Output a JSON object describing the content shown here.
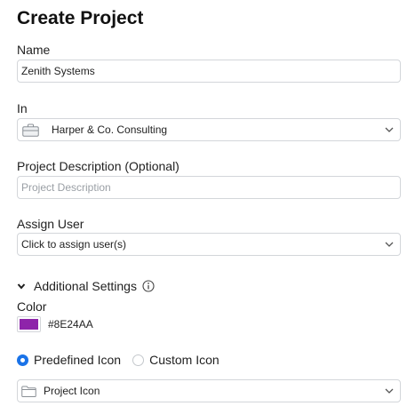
{
  "header": {
    "title": "Create Project"
  },
  "form": {
    "name": {
      "label": "Name",
      "value": "Zenith Systems"
    },
    "parent": {
      "label": "In",
      "value": "Harper & Co. Consulting",
      "icon": "briefcase-icon"
    },
    "description": {
      "label": "Project Description (Optional)",
      "placeholder": "Project Description"
    },
    "assign_user": {
      "label": "Assign User",
      "value": "Click to assign user(s)"
    },
    "additional_settings": {
      "label": "Additional Settings",
      "expanded": true,
      "color": {
        "label": "Color",
        "value": "#8E24AA"
      },
      "icon_type": {
        "options": [
          "Predefined Icon",
          "Custom Icon"
        ],
        "selected": "Predefined Icon"
      },
      "icon_select": {
        "value": "Project Icon",
        "icon": "folder-icon"
      }
    }
  },
  "colors": {
    "accent": "#1a73e8",
    "swatch": "#8E24AA",
    "border": "#d3d6da"
  }
}
